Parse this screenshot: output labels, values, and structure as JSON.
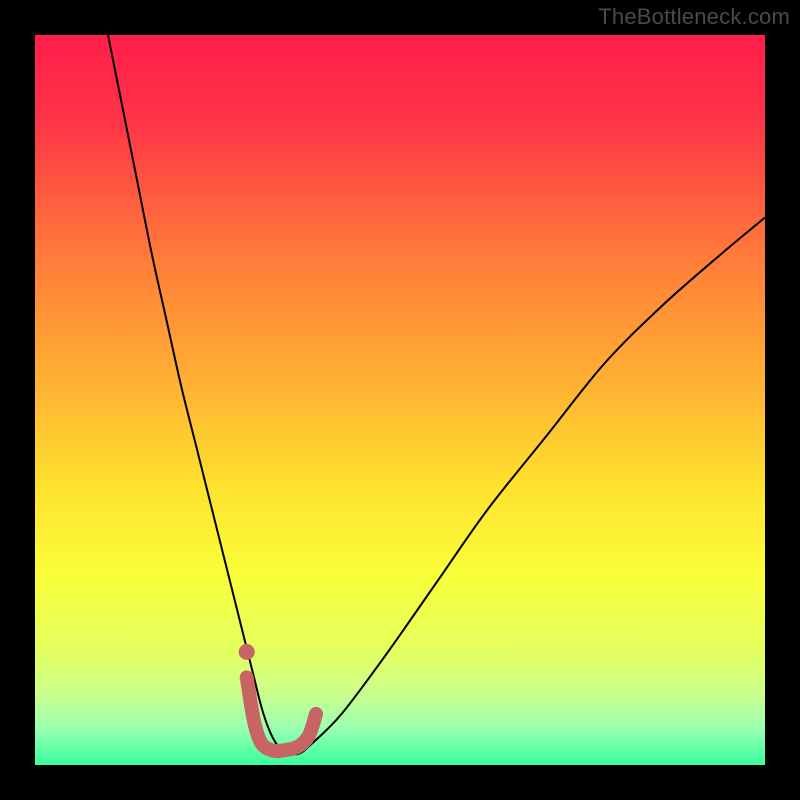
{
  "watermark": "TheBottleneck.com",
  "chart_data": {
    "type": "line",
    "title": "",
    "xlabel": "",
    "ylabel": "",
    "xlim": [
      0,
      100
    ],
    "ylim": [
      0,
      100
    ],
    "grid": false,
    "background": {
      "type": "vertical-gradient",
      "stops": [
        {
          "offset": 0.0,
          "color": "#ff1e4b"
        },
        {
          "offset": 0.12,
          "color": "#ff3547"
        },
        {
          "offset": 0.3,
          "color": "#ff7a3a"
        },
        {
          "offset": 0.48,
          "color": "#ffb232"
        },
        {
          "offset": 0.62,
          "color": "#ffe22e"
        },
        {
          "offset": 0.74,
          "color": "#f9ff3a"
        },
        {
          "offset": 0.84,
          "color": "#e4ff5e"
        },
        {
          "offset": 0.9,
          "color": "#ccff8a"
        },
        {
          "offset": 0.95,
          "color": "#9affb0"
        },
        {
          "offset": 1.0,
          "color": "#35ff9e"
        }
      ]
    },
    "series": [
      {
        "name": "curve",
        "color": "#000000",
        "stroke_width": 2,
        "x": [
          10,
          12,
          14,
          16,
          18,
          20,
          22,
          24,
          26,
          28,
          29,
          30,
          31,
          32,
          33,
          34,
          36,
          38,
          42,
          48,
          55,
          62,
          70,
          78,
          86,
          94,
          100
        ],
        "y": [
          100,
          90,
          80,
          70,
          61,
          52,
          44,
          36,
          28,
          20,
          16,
          12,
          8,
          5,
          3,
          2,
          1.5,
          3,
          7,
          15,
          25,
          35,
          45,
          55,
          63,
          70,
          75
        ]
      },
      {
        "name": "highlight",
        "color": "#c86464",
        "stroke_width": 14,
        "linecap": "round",
        "x": [
          29.0,
          30.0,
          31.0,
          32.5,
          34.0,
          36.0,
          37.5,
          38.5
        ],
        "y": [
          12.0,
          6.0,
          3.0,
          2.0,
          2.0,
          2.5,
          4.0,
          7.0
        ]
      }
    ],
    "markers": [
      {
        "name": "highlight-dot",
        "x": 29.0,
        "y": 15.5,
        "r": 8,
        "color": "#c86464"
      }
    ]
  }
}
